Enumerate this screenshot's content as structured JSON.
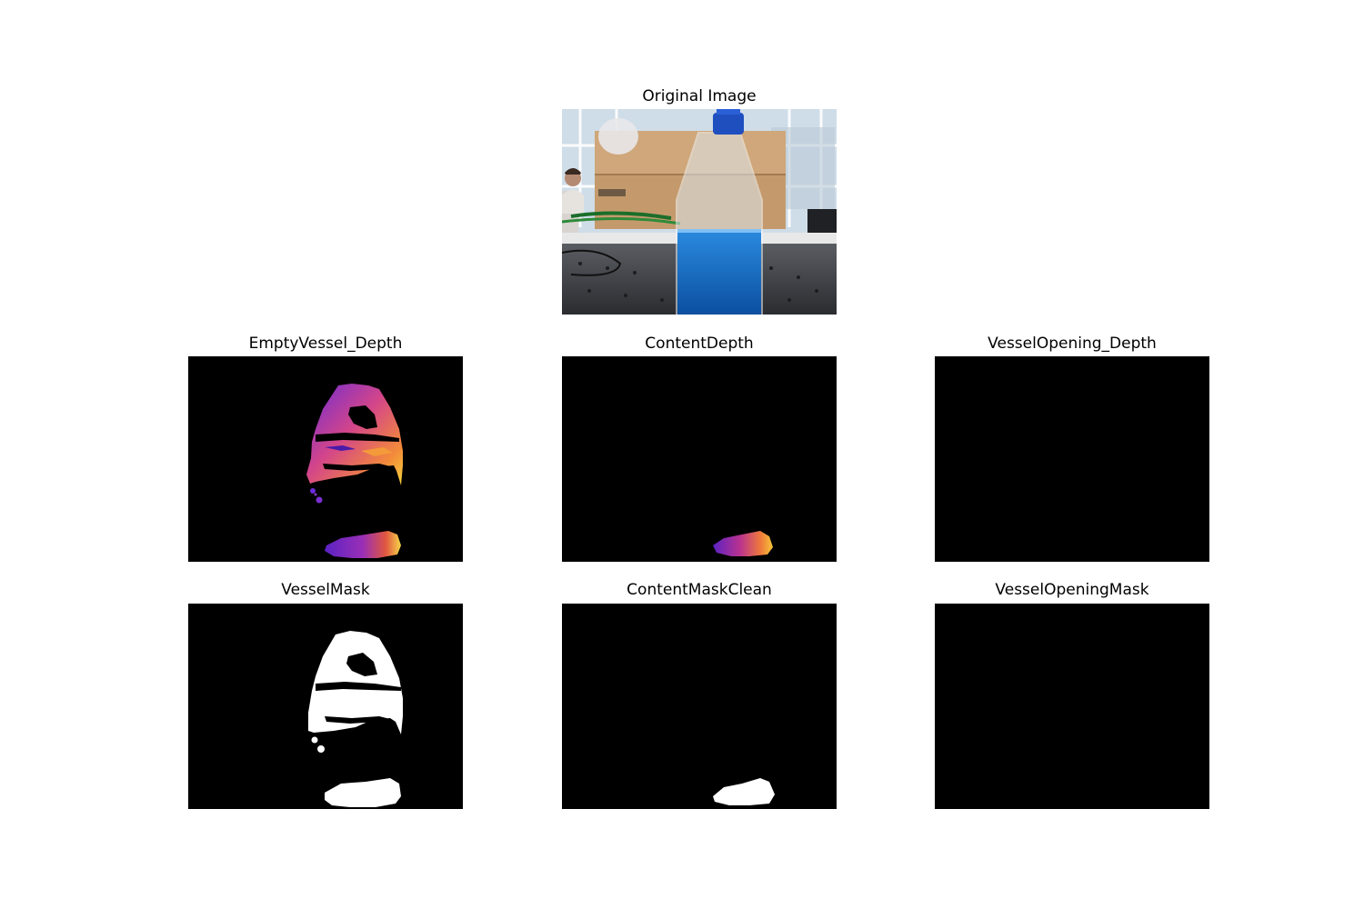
{
  "figure": {
    "panels": [
      {
        "id": "original",
        "title": "Original Image"
      },
      {
        "id": "empty-vessel-depth",
        "title": "EmptyVessel_Depth"
      },
      {
        "id": "content-depth",
        "title": "ContentDepth"
      },
      {
        "id": "vessel-opening-depth",
        "title": "VesselOpening_Depth"
      },
      {
        "id": "vessel-mask",
        "title": "VesselMask"
      },
      {
        "id": "content-mask-clean",
        "title": "ContentMaskClean"
      },
      {
        "id": "vessel-opening-mask",
        "title": "VesselOpeningMask"
      }
    ]
  }
}
